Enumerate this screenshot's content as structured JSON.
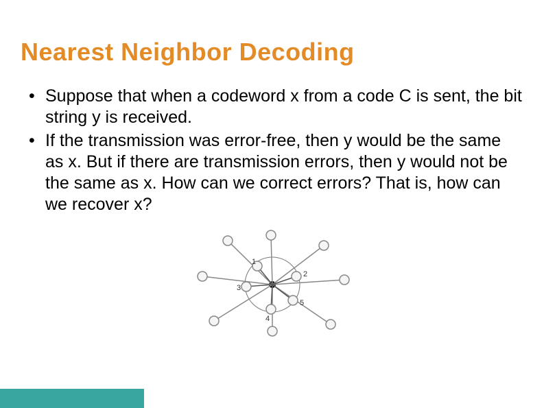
{
  "title": "Nearest Neighbor Decoding",
  "bullets": [
    "Suppose that when a codeword x from a code C is sent, the bit string y is received.",
    "If the transmission was error-free, then y would be the same as x. But if there are transmission errors, then y would not be the same as x. How can we correct errors? That is, how can we recover x?"
  ],
  "diagram": {
    "labels": [
      "1",
      "2",
      "3",
      "4",
      "5"
    ]
  },
  "colors": {
    "title": "#e38b27",
    "footer": "#3aa6a0"
  }
}
